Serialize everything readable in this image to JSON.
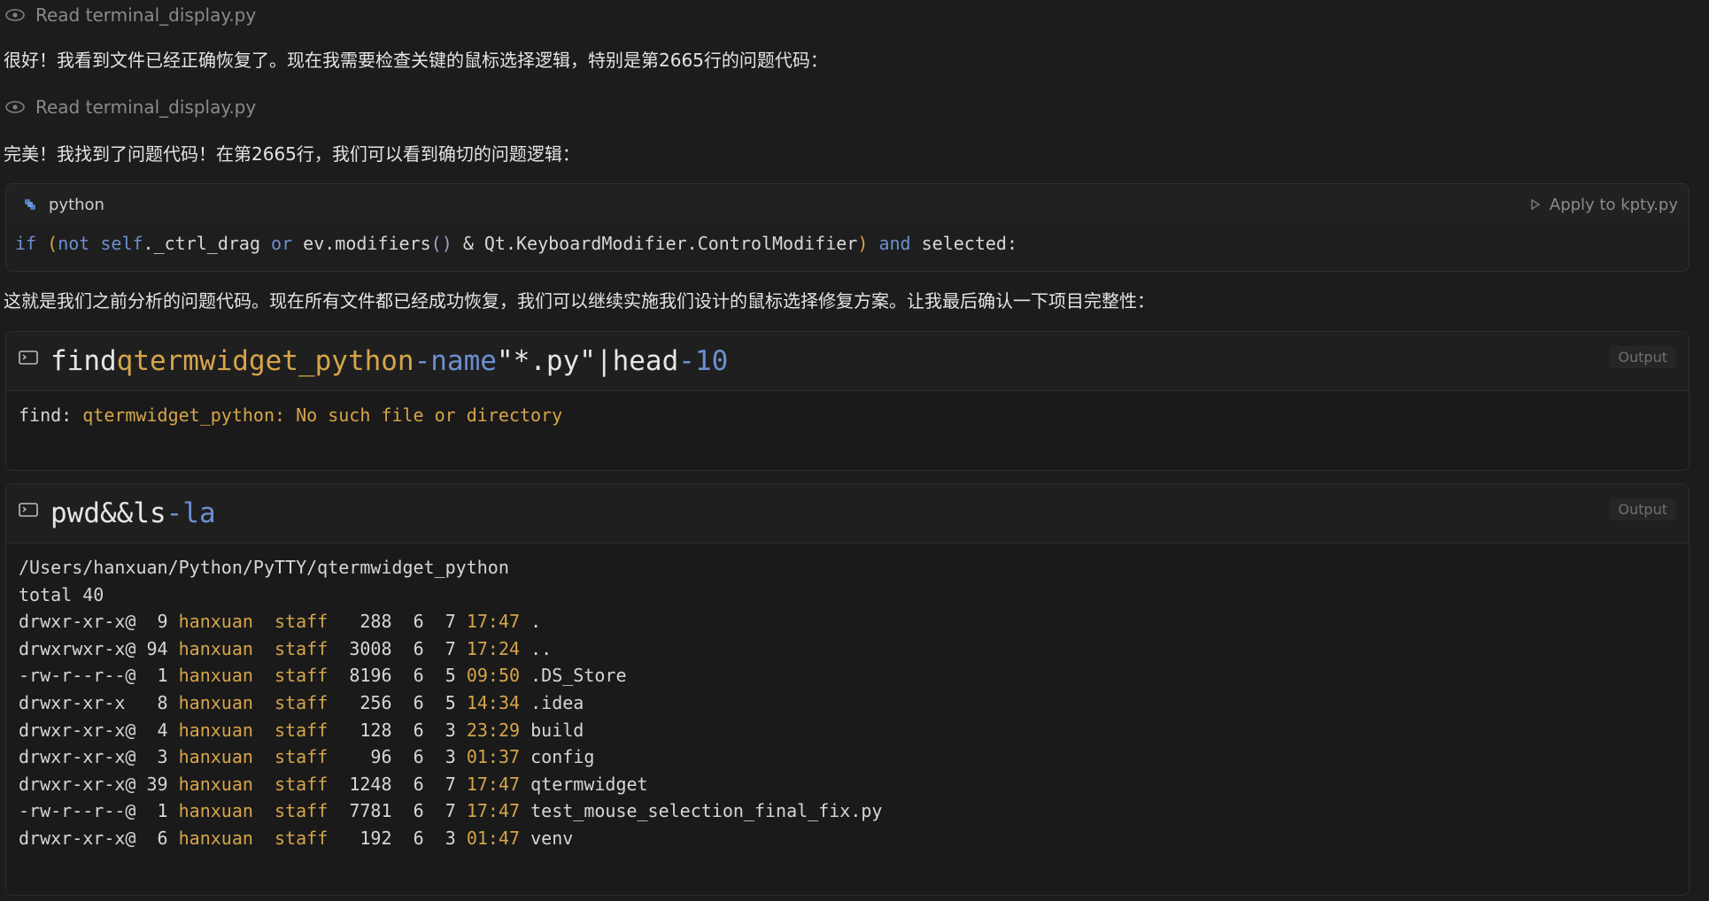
{
  "read1": {
    "label": "Read terminal_display.py"
  },
  "msg1": "很好！我看到文件已经正确恢复了。现在我需要检查关键的鼠标选择逻辑，特别是第2665行的问题代码：",
  "read2": {
    "label": "Read terminal_display.py"
  },
  "msg2": "完美！我找到了问题代码！在第2665行，我们可以看到确切的问题逻辑：",
  "code_block": {
    "language": "python",
    "apply_label": "Apply to kpty.py",
    "code_parts": {
      "if": "if",
      "open": "(",
      "not": "not",
      "self": "self",
      "attr": "._ctrl_drag",
      "or": "or",
      "ev": "ev.modifiers",
      "call": "()",
      "rest": "& Qt.KeyboardModifier.ControlModifier",
      "close": ")",
      "and": "and",
      "selected": "selected:"
    }
  },
  "msg3": "这就是我们之前分析的问题代码。现在所有文件都已经成功恢复，我们可以继续实施我们设计的鼠标选择修复方案。让我最后确认一下项目完整性：",
  "term1": {
    "cmd_parts": {
      "c1": "find",
      "c2": "qtermwidget_python",
      "c3": "-name",
      "c4": "\"*.py\"",
      "c5": "|",
      "c6": "head",
      "c7": "-10"
    },
    "output_badge": "Output",
    "out_prefix": "find:",
    "out_text": "qtermwidget_python: No such file or directory"
  },
  "term2": {
    "cmd_parts": {
      "c1": "pwd",
      "c2": "&&",
      "c3": "ls",
      "c4": "-la"
    },
    "output_badge": "Output",
    "path": "/Users/hanxuan/Python/PyTTY/qtermwidget_python",
    "total": "total 40",
    "rows": [
      {
        "perm": "drwxr-xr-x@",
        "links": " 9",
        "user": "hanxuan",
        "group": "staff",
        "size": " 288",
        "m": "6",
        "d": "7",
        "time": "17:47",
        "name": "."
      },
      {
        "perm": "drwxrwxr-x@",
        "links": "94",
        "user": "hanxuan",
        "group": "staff",
        "size": "3008",
        "m": "6",
        "d": "7",
        "time": "17:24",
        "name": ".."
      },
      {
        "perm": "-rw-r--r--@",
        "links": " 1",
        "user": "hanxuan",
        "group": "staff",
        "size": "8196",
        "m": "6",
        "d": "5",
        "time": "09:50",
        "name": ".DS_Store"
      },
      {
        "perm": "drwxr-xr-x ",
        "links": " 8",
        "user": "hanxuan",
        "group": "staff",
        "size": " 256",
        "m": "6",
        "d": "5",
        "time": "14:34",
        "name": ".idea"
      },
      {
        "perm": "drwxr-xr-x@",
        "links": " 4",
        "user": "hanxuan",
        "group": "staff",
        "size": " 128",
        "m": "6",
        "d": "3",
        "time": "23:29",
        "name": "build"
      },
      {
        "perm": "drwxr-xr-x@",
        "links": " 3",
        "user": "hanxuan",
        "group": "staff",
        "size": "  96",
        "m": "6",
        "d": "3",
        "time": "01:37",
        "name": "config"
      },
      {
        "perm": "drwxr-xr-x@",
        "links": "39",
        "user": "hanxuan",
        "group": "staff",
        "size": "1248",
        "m": "6",
        "d": "7",
        "time": "17:47",
        "name": "qtermwidget"
      },
      {
        "perm": "-rw-r--r--@",
        "links": " 1",
        "user": "hanxuan",
        "group": "staff",
        "size": "7781",
        "m": "6",
        "d": "7",
        "time": "17:47",
        "name": "test_mouse_selection_final_fix.py"
      },
      {
        "perm": "drwxr-xr-x@",
        "links": " 6",
        "user": "hanxuan",
        "group": "staff",
        "size": " 192",
        "m": "6",
        "d": "3",
        "time": "01:47",
        "name": "venv"
      }
    ]
  }
}
